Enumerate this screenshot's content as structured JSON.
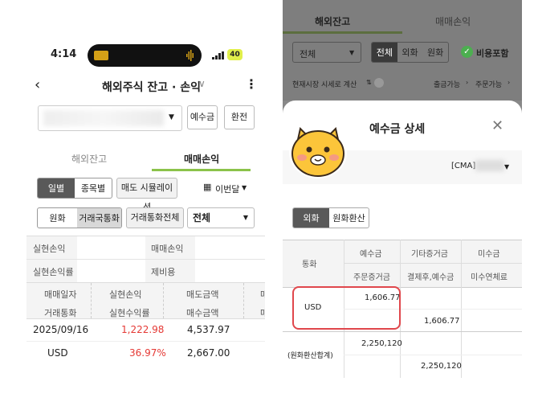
{
  "left": {
    "status": {
      "time": "4:14",
      "battery": "40"
    },
    "header": {
      "title": "해외주식 잔고 · 손익"
    },
    "buttons": {
      "deposit": "예수금",
      "exchange": "환전"
    },
    "tabs": [
      {
        "label": "해외잔고"
      },
      {
        "label": "매매손익"
      }
    ],
    "period_seg": [
      {
        "label": "일별"
      },
      {
        "label": "종목별"
      }
    ],
    "sell_sim": "매도 시뮬레이션",
    "period_select": "이번달",
    "currency_seg": [
      {
        "label": "원화"
      },
      {
        "label": "거래국통화"
      }
    ],
    "all_currency": "거래통화전체",
    "filter_select": "전체",
    "summary": {
      "realized_pl": "실현손익",
      "trade_pl": "매매손익",
      "realized_rate": "실현손익률",
      "fees": "제비용"
    },
    "table": {
      "headers_row1": [
        "매매일자",
        "실현손익",
        "매도금액",
        "매"
      ],
      "headers_row2": [
        "거래통화",
        "실현수익률",
        "매수금액",
        "매"
      ],
      "rows": [
        {
          "c1": "2025/09/16",
          "c2": "1,222.98",
          "c3": "4,537.97"
        },
        {
          "c1": "USD",
          "c2": "36.97%",
          "c3": "2,667.00"
        }
      ]
    },
    "colors": {
      "accent": "#8bc34a",
      "profit": "#e53935"
    }
  },
  "right": {
    "tabs": [
      {
        "label": "해외잔고"
      },
      {
        "label": "매매손익"
      }
    ],
    "filter_select": "전체",
    "seg": [
      {
        "label": "전체"
      },
      {
        "label": "외화"
      },
      {
        "label": "원화"
      }
    ],
    "cost_incl": "비용포함",
    "price_basis": "현재시장 시세로 계산",
    "sell_avail": "출금가능",
    "order_avail": "주문가능",
    "sheet": {
      "title": "예수금 상세",
      "account": "[CMA]",
      "seg": [
        {
          "label": "외화"
        },
        {
          "label": "원화환산"
        }
      ],
      "table": {
        "currency_header": "통화",
        "h1": [
          "예수금",
          "기타증거금",
          "미수금"
        ],
        "h2": [
          "주문증거금",
          "결제후,예수금",
          "미수연체료"
        ],
        "usd": {
          "label": "USD",
          "deposit": "1,606.77",
          "after_settle": "1,606.77"
        },
        "krw": {
          "label": "(원화환산합계)",
          "deposit": "2,250,120",
          "after_settle": "2,250,120"
        }
      }
    },
    "colors": {
      "highlight": "#e0474c",
      "check": "#4caf50"
    }
  }
}
